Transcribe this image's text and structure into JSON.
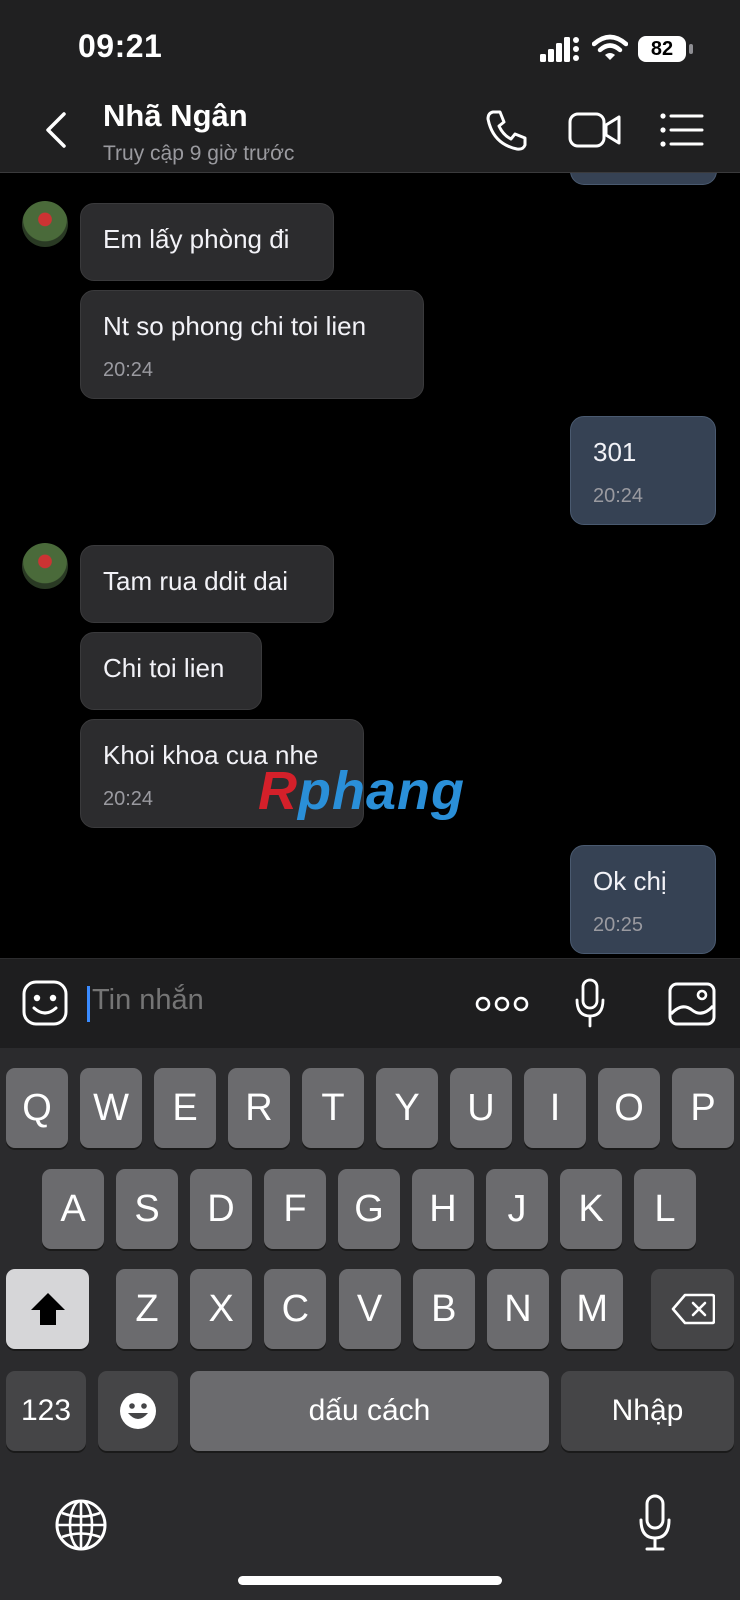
{
  "status_bar": {
    "time": "09:21",
    "battery": "82"
  },
  "header": {
    "name": "Nhã Ngân",
    "last_seen": "Truy cập 9 giờ trước"
  },
  "messages": [
    {
      "side": "in",
      "text": "Em lấy phòng đi",
      "time": ""
    },
    {
      "side": "in",
      "text": "Nt so phong chi toi lien",
      "time": "20:24"
    },
    {
      "side": "out",
      "text": "301",
      "time": "20:24"
    },
    {
      "side": "in",
      "text": "Tam rua ddit dai",
      "time": ""
    },
    {
      "side": "in",
      "text": "Chi toi lien",
      "time": ""
    },
    {
      "side": "in",
      "text": "Khoi khoa cua nhe",
      "time": "20:24"
    },
    {
      "side": "out",
      "text": "Ok chị",
      "time": "20:25"
    }
  ],
  "watermark": {
    "text_a": "R",
    "text_b": "phang",
    "color_a": "#d4202a",
    "color_b": "#2a8fd8"
  },
  "composer": {
    "placeholder": "Tin nhắn"
  },
  "keyboard": {
    "row1": [
      "Q",
      "W",
      "E",
      "R",
      "T",
      "Y",
      "U",
      "I",
      "O",
      "P"
    ],
    "row2": [
      "A",
      "S",
      "D",
      "F",
      "G",
      "H",
      "J",
      "K",
      "L"
    ],
    "row3": [
      "Z",
      "X",
      "C",
      "V",
      "B",
      "N",
      "M"
    ],
    "numbers_label": "123",
    "space_label": "dấu cách",
    "return_label": "Nhập"
  },
  "colors": {
    "header_bg": "#202021",
    "incoming_bubble": "#2c2c2e",
    "outgoing_bubble": "#364254",
    "cursor": "#3a8bff"
  }
}
